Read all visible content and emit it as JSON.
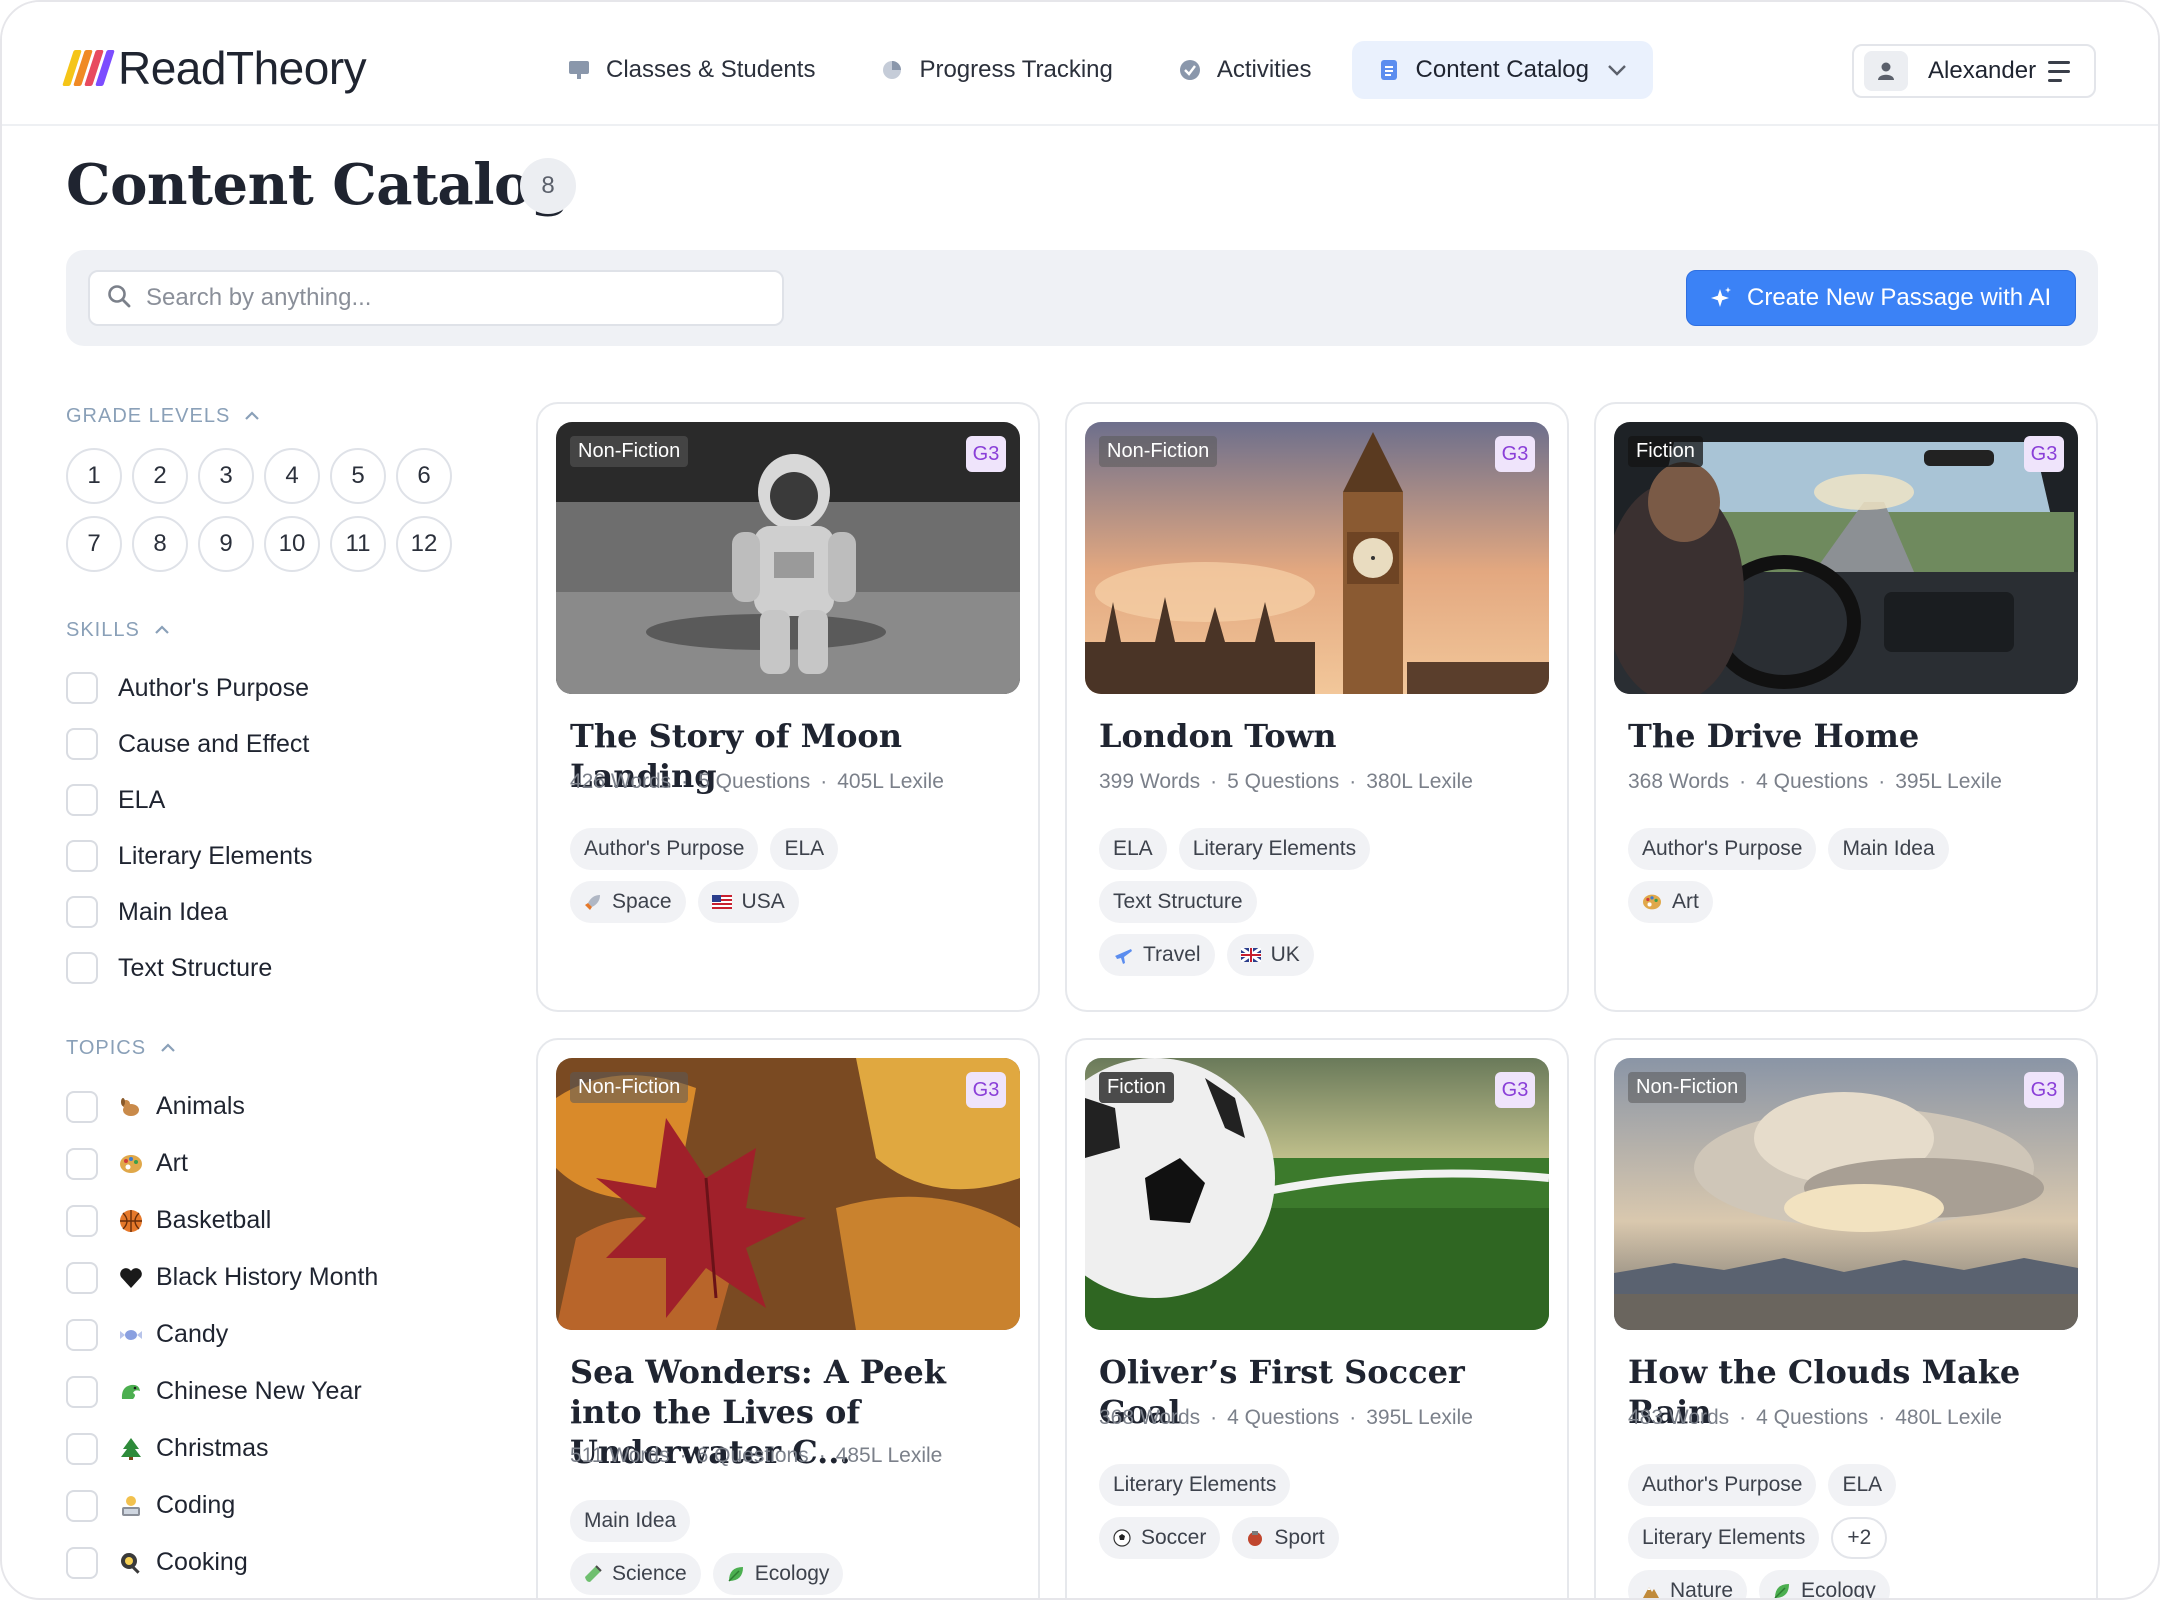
{
  "app": {
    "logo_text": "ReadTheory",
    "logo_colors": [
      "#f5c518",
      "#f08a24",
      "#e84a5f",
      "#7c4dff"
    ]
  },
  "nav": {
    "items": [
      {
        "label": "Classes & Students",
        "icon": "classroom-icon"
      },
      {
        "label": "Progress Tracking",
        "icon": "pie-chart-icon"
      },
      {
        "label": "Activities",
        "icon": "check-circle-icon"
      },
      {
        "label": "Content Catalog",
        "icon": "document-icon",
        "active": true
      }
    ],
    "accent": "#eaf1fd"
  },
  "user": {
    "name": "Alexander"
  },
  "page": {
    "title": "Content Catalog",
    "count": "8"
  },
  "search": {
    "placeholder": "Search by anything..."
  },
  "ai_button": {
    "label": "Create New Passage with AI",
    "color": "#3b82f6"
  },
  "filters": {
    "grade_levels": {
      "title": "GRADE LEVELS",
      "grades": [
        "1",
        "2",
        "3",
        "4",
        "5",
        "6",
        "7",
        "8",
        "9",
        "10",
        "11",
        "12"
      ]
    },
    "skills": {
      "title": "SKILLS",
      "items": [
        "Author's Purpose",
        "Cause and Effect",
        "ELA",
        "Literary Elements",
        "Main Idea",
        "Text Structure"
      ]
    },
    "topics": {
      "title": "TOPICS",
      "items": [
        {
          "label": "Animals",
          "icon": "dog-icon"
        },
        {
          "label": "Art",
          "icon": "palette-icon"
        },
        {
          "label": "Basketball",
          "icon": "basketball-icon"
        },
        {
          "label": "Black History Month",
          "icon": "black-heart-icon"
        },
        {
          "label": "Candy",
          "icon": "candy-icon"
        },
        {
          "label": "Chinese New Year",
          "icon": "dragon-icon"
        },
        {
          "label": "Christmas",
          "icon": "christmas-tree-icon"
        },
        {
          "label": "Coding",
          "icon": "technologist-icon"
        },
        {
          "label": "Cooking",
          "icon": "frying-pan-icon"
        }
      ]
    }
  },
  "cards": [
    {
      "genre": "Non-Fiction",
      "grade": "G3",
      "image": "astronaut-moon-photo",
      "title": "The Story of Moon Landing",
      "words": "426 Words",
      "questions": "5 Questions",
      "lexile": "405L Lexile",
      "skill_rows": [
        [
          "Author's Purpose",
          "ELA"
        ]
      ],
      "topic_rows": [
        [
          {
            "label": "Space",
            "icon": "rocket-icon"
          },
          {
            "label": "USA",
            "icon": "us-flag-icon"
          }
        ]
      ]
    },
    {
      "genre": "Non-Fiction",
      "grade": "G3",
      "image": "big-ben-photo",
      "title": "London Town",
      "words": "399 Words",
      "questions": "5 Questions",
      "lexile": "380L Lexile",
      "skill_rows": [
        [
          "ELA",
          "Literary Elements"
        ],
        [
          "Text Structure"
        ]
      ],
      "topic_rows": [
        [
          {
            "label": "Travel",
            "icon": "airplane-icon"
          },
          {
            "label": "UK",
            "icon": "uk-flag-icon"
          }
        ]
      ]
    },
    {
      "genre": "Fiction",
      "grade": "G3",
      "image": "car-interior-photo",
      "title": "The Drive Home",
      "words": "368 Words",
      "questions": "4 Questions",
      "lexile": "395L Lexile",
      "skill_rows": [
        [
          "Author's Purpose",
          "Main Idea"
        ]
      ],
      "topic_rows": [
        [
          {
            "label": "Art",
            "icon": "palette-icon"
          }
        ]
      ]
    },
    {
      "genre": "Non-Fiction",
      "grade": "G3",
      "image": "autumn-leaves-photo",
      "title": "Sea Wonders: A Peek into the Lives of Underwater C...",
      "words": "511 Words",
      "questions": "6 Questions",
      "lexile": "485L Lexile",
      "skill_rows": [
        [
          "Main Idea"
        ]
      ],
      "topic_rows": [
        [
          {
            "label": "Science",
            "icon": "test-tube-icon"
          },
          {
            "label": "Ecology",
            "icon": "leaf-icon"
          }
        ]
      ]
    },
    {
      "genre": "Fiction",
      "grade": "G3",
      "image": "soccer-ball-photo",
      "title": "Oliver’s First Soccer Goal",
      "words": "368 Words",
      "questions": "4 Questions",
      "lexile": "395L Lexile",
      "skill_rows": [
        [
          "Literary Elements"
        ]
      ],
      "topic_rows": [
        [
          {
            "label": "Soccer",
            "icon": "soccer-ball-icon"
          },
          {
            "label": "Sport",
            "icon": "sport-icon"
          }
        ]
      ]
    },
    {
      "genre": "Non-Fiction",
      "grade": "G3",
      "image": "clouds-sky-photo",
      "title": "How the Clouds Make Rain",
      "words": "483 Words",
      "questions": "4 Questions",
      "lexile": "480L Lexile",
      "skill_rows": [
        [
          "Author's Purpose",
          "ELA"
        ],
        [
          "Literary Elements",
          "+2"
        ]
      ],
      "topic_rows": [
        [
          {
            "label": "Nature",
            "icon": "mountain-icon"
          },
          {
            "label": "Ecology",
            "icon": "leaf-icon"
          }
        ]
      ]
    }
  ]
}
